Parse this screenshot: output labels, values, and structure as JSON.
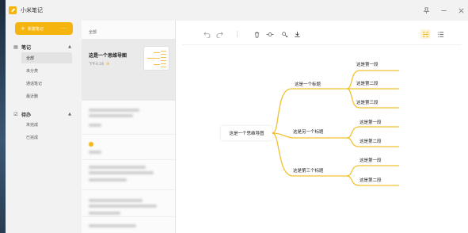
{
  "app": {
    "title": "小米笔记",
    "window_controls": {
      "pin": "pin-icon",
      "minimize": "minimize-icon",
      "close": "close-icon"
    }
  },
  "sidebar": {
    "new_note_label": "新建笔记",
    "new_note_more": "···",
    "notes_section": {
      "label": "笔记",
      "items": [
        "全部",
        "未分类",
        "通话笔记",
        "最近删"
      ]
    },
    "todo_section": {
      "label": "待办",
      "items": [
        "未完成",
        "已完成"
      ]
    }
  },
  "note_list": {
    "header": "全部",
    "selected_note": {
      "title": "这是一个思维导图",
      "time": "下午4:16"
    }
  },
  "toolbar": {
    "icons": [
      "undo-icon",
      "redo-icon",
      "delete-icon",
      "add-node-icon",
      "link-icon",
      "download-icon",
      "outline-view-icon",
      "list-view-icon"
    ]
  },
  "mind_map": {
    "root": "这是一个思维导图",
    "branches": [
      {
        "label": "这是一个标题",
        "children": [
          "这是第一段",
          "这是第二段",
          "这是第三段"
        ]
      },
      {
        "label": "这是另一个标题",
        "children": [
          "这是第一段",
          "这是第二段"
        ]
      },
      {
        "label": "这是第三个标题",
        "children": [
          "这是第一段",
          "这是第二段"
        ]
      }
    ]
  },
  "colors": {
    "accent": "#f6b40e",
    "branch_line": "#f2c12e",
    "selected_note_bg": "#eaeaea"
  }
}
